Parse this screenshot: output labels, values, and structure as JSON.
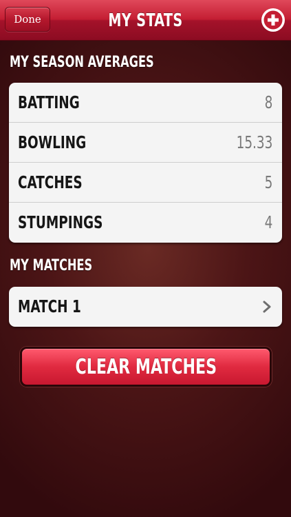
{
  "navbar": {
    "done_label": "Done",
    "title": "MY STATS",
    "add_icon": "plus-circle-icon"
  },
  "averages": {
    "header": "MY SEASON AVERAGES",
    "rows": [
      {
        "label": "BATTING",
        "value": "8"
      },
      {
        "label": "BOWLING",
        "value": "15.33"
      },
      {
        "label": "CATCHES",
        "value": "5"
      },
      {
        "label": "STUMPINGS",
        "value": "4"
      }
    ]
  },
  "matches": {
    "header": "MY MATCHES",
    "items": [
      {
        "label": "MATCH 1",
        "icon": "chevron-right-icon"
      }
    ]
  },
  "clear_button": {
    "label": "CLEAR MATCHES"
  },
  "colors": {
    "accent_red": "#c41e33",
    "background_dark": "#4c1516",
    "card_bg": "#f4f4f4",
    "value_gray": "#7a7a7a"
  }
}
